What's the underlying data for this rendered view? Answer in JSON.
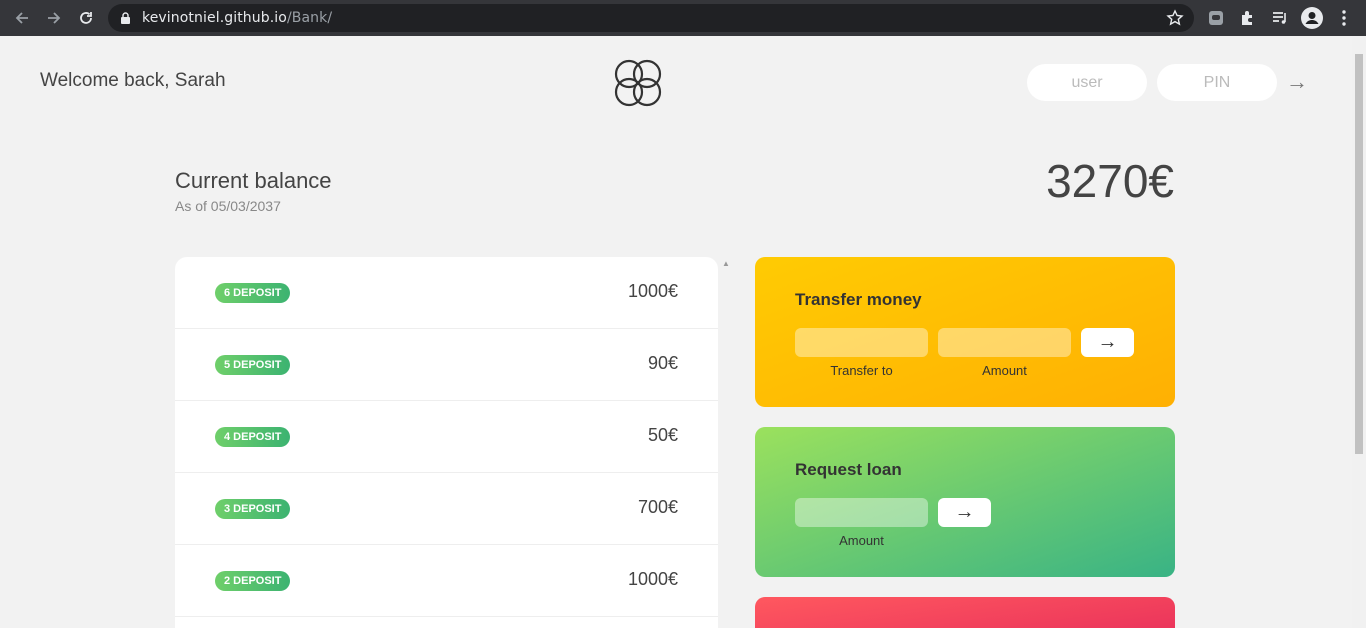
{
  "browser": {
    "url_host": "kevinotniel.github.io",
    "url_path": "/Bank/"
  },
  "header": {
    "welcome": "Welcome back, Sarah",
    "login_user_placeholder": "user",
    "login_pin_placeholder": "PIN",
    "login_arrow": "→"
  },
  "balance": {
    "label": "Current balance",
    "date": "As of 05/03/2037",
    "amount": "3270€"
  },
  "movements": [
    {
      "type": "6 DEPOSIT",
      "value": "1000€"
    },
    {
      "type": "5 DEPOSIT",
      "value": "90€"
    },
    {
      "type": "4 DEPOSIT",
      "value": "50€"
    },
    {
      "type": "3 DEPOSIT",
      "value": "700€"
    },
    {
      "type": "2 DEPOSIT",
      "value": "1000€"
    }
  ],
  "operations": {
    "transfer": {
      "title": "Transfer money",
      "to_label": "Transfer to",
      "amount_label": "Amount",
      "button": "→"
    },
    "loan": {
      "title": "Request loan",
      "amount_label": "Amount",
      "button": "→"
    }
  },
  "colors": {
    "transfer_gradient": [
      "#ffcb03",
      "#ffb003"
    ],
    "loan_gradient": [
      "#9be15d",
      "#39b385"
    ],
    "close_gradient": [
      "#ff585f",
      "#e52a5a"
    ],
    "deposit_badge": [
      "#6fcf6a",
      "#3cb371"
    ]
  }
}
